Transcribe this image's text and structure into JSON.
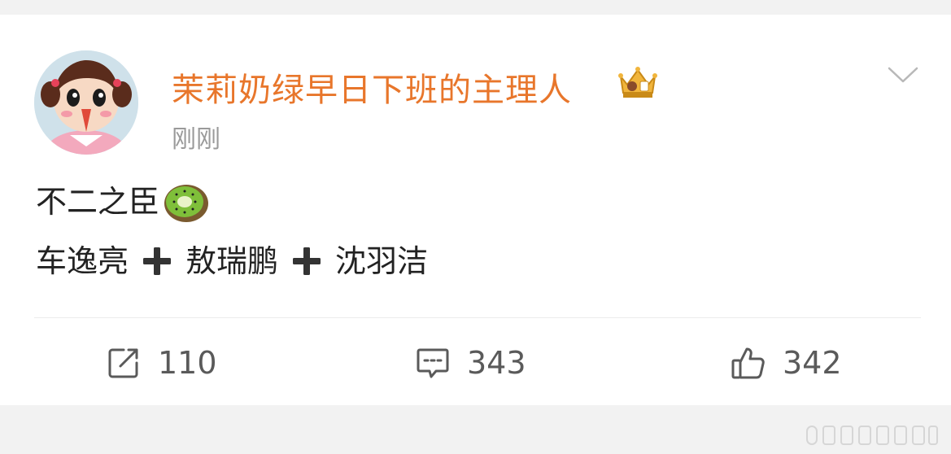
{
  "post": {
    "username": "茉莉奶绿早日下班的主理人",
    "timestamp": "刚刚",
    "content": {
      "line1": "不二之臣",
      "line2_names": [
        "车逸亮",
        "敖瑞鹏",
        "沈羽洁"
      ]
    },
    "actions": {
      "repost_count": "110",
      "comment_count": "343",
      "like_count": "342"
    }
  },
  "icons": {
    "avatar": "cartoon-girl-avatar",
    "badge": "crown-badge-icon",
    "more": "chevron-down-icon",
    "emoji": "kiwi-emoji",
    "plus": "plus-icon",
    "repost": "repost-icon",
    "comment": "comment-icon",
    "like": "thumbs-up-icon"
  },
  "colors": {
    "username": "#e8762b",
    "timestamp": "#9a9a9a",
    "text": "#222222",
    "action": "#5a5a5a",
    "background": "#f2f2f2",
    "card": "#ffffff"
  }
}
